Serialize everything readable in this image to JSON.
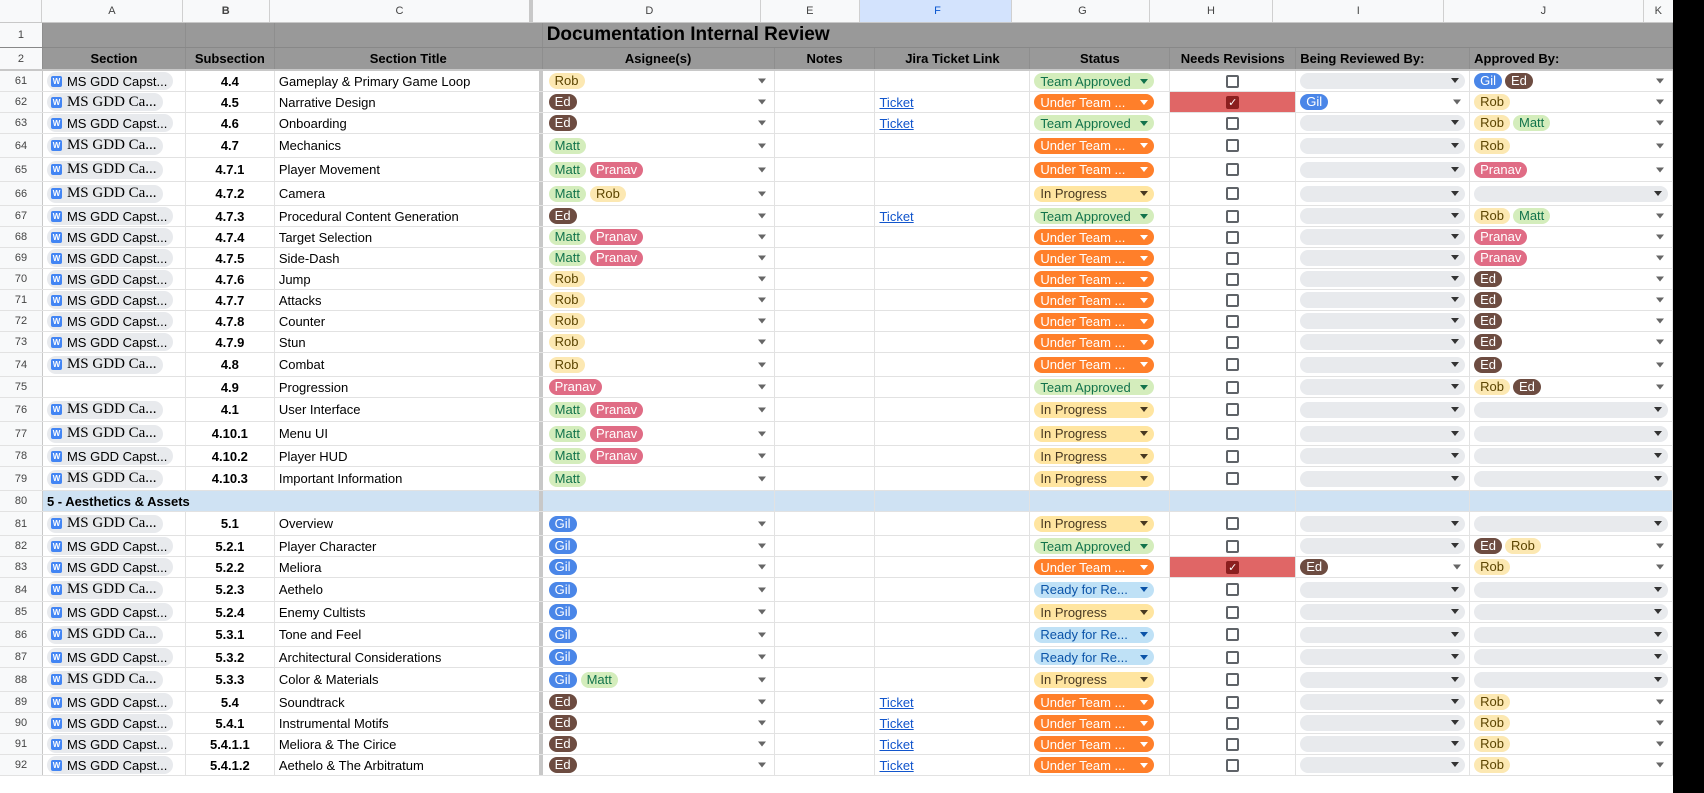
{
  "columns": [
    "A",
    "B",
    "C",
    "D",
    "E",
    "F",
    "G",
    "H",
    "I",
    "J",
    "K"
  ],
  "selected_column": "F",
  "title": "Documentation Internal Review",
  "headers": {
    "section": "Section",
    "subsection": "Subsection",
    "section_title": "Section Title",
    "assignees": "Asignee(s)",
    "notes": "Notes",
    "jira": "Jira Ticket Link",
    "status": "Status",
    "needs_revisions": "Needs Revisions",
    "being_reviewed_by": "Being Reviewed By:",
    "approved_by": "Approved By:"
  },
  "row_numbers": {
    "r1": "1",
    "r2": "2"
  },
  "colors": {
    "header_bg": "#999999",
    "section_bg": "#cfe2f3",
    "flag_bg": "#e06666"
  },
  "rows": [
    {
      "n": "61",
      "doc": "MS GDD Capst...",
      "serif": false,
      "sub": "4.4",
      "title": "Gameplay & Primary Game Loop",
      "assignees": [
        {
          "name": "Rob",
          "c": "rob"
        }
      ],
      "ticket": "",
      "status": "Team Approved",
      "sc": "st-approved",
      "needs": false,
      "reviewed": [],
      "approved": [
        {
          "name": "Gil",
          "c": "gil"
        },
        {
          "name": "Ed",
          "c": "ed"
        }
      ],
      "tall": false
    },
    {
      "n": "62",
      "doc": "MS GDD Ca...",
      "serif": true,
      "sub": "4.5",
      "title": "Narrative Design",
      "assignees": [
        {
          "name": "Ed",
          "c": "ed"
        }
      ],
      "ticket": "Ticket",
      "status": "Under Team ...",
      "sc": "st-under",
      "needs": true,
      "reviewed": [
        {
          "name": "Gil",
          "c": "gil"
        }
      ],
      "approved": [
        {
          "name": "Rob",
          "c": "rob"
        }
      ],
      "tall": false
    },
    {
      "n": "63",
      "doc": "MS GDD Capst...",
      "serif": false,
      "sub": "4.6",
      "title": "Onboarding",
      "assignees": [
        {
          "name": "Ed",
          "c": "ed"
        }
      ],
      "ticket": "Ticket",
      "status": "Team Approved",
      "sc": "st-approved",
      "needs": false,
      "reviewed": [],
      "approved": [
        {
          "name": "Rob",
          "c": "rob"
        },
        {
          "name": "Matt",
          "c": "matt"
        }
      ],
      "tall": false
    },
    {
      "n": "64",
      "doc": "MS GDD Ca...",
      "serif": true,
      "sub": "4.7",
      "title": "Mechanics",
      "assignees": [
        {
          "name": "Matt",
          "c": "matt"
        }
      ],
      "ticket": "",
      "status": "Under Team ...",
      "sc": "st-under",
      "needs": false,
      "reviewed": [],
      "approved": [
        {
          "name": "Rob",
          "c": "rob"
        }
      ],
      "tall": true
    },
    {
      "n": "65",
      "doc": "MS GDD Ca...",
      "serif": true,
      "sub": "4.7.1",
      "title": "Player Movement",
      "assignees": [
        {
          "name": "Matt",
          "c": "matt"
        },
        {
          "name": "Pranav",
          "c": "pranav"
        }
      ],
      "ticket": "",
      "status": "Under Team ...",
      "sc": "st-under",
      "needs": false,
      "reviewed": [],
      "approved": [
        {
          "name": "Pranav",
          "c": "pranav"
        }
      ],
      "tall": true
    },
    {
      "n": "66",
      "doc": "MS GDD Ca...",
      "serif": true,
      "sub": "4.7.2",
      "title": "Camera",
      "assignees": [
        {
          "name": "Matt",
          "c": "matt"
        },
        {
          "name": "Rob",
          "c": "rob"
        }
      ],
      "ticket": "",
      "status": "In Progress",
      "sc": "st-progress",
      "needs": false,
      "reviewed": [],
      "approved": [],
      "tall": true
    },
    {
      "n": "67",
      "doc": "MS GDD Capst...",
      "serif": false,
      "sub": "4.7.3",
      "title": "Procedural Content Generation",
      "assignees": [
        {
          "name": "Ed",
          "c": "ed"
        }
      ],
      "ticket": "Ticket",
      "status": "Team Approved",
      "sc": "st-approved",
      "needs": false,
      "reviewed": [],
      "approved": [
        {
          "name": "Rob",
          "c": "rob"
        },
        {
          "name": "Matt",
          "c": "matt"
        }
      ],
      "tall": false
    },
    {
      "n": "68",
      "doc": "MS GDD Capst...",
      "serif": false,
      "sub": "4.7.4",
      "title": "Target Selection",
      "assignees": [
        {
          "name": "Matt",
          "c": "matt"
        },
        {
          "name": "Pranav",
          "c": "pranav"
        }
      ],
      "ticket": "",
      "status": "Under Team ...",
      "sc": "st-under",
      "needs": false,
      "reviewed": [],
      "approved": [
        {
          "name": "Pranav",
          "c": "pranav"
        }
      ],
      "tall": false
    },
    {
      "n": "69",
      "doc": "MS GDD Capst...",
      "serif": false,
      "sub": "4.7.5",
      "title": "Side-Dash",
      "assignees": [
        {
          "name": "Matt",
          "c": "matt"
        },
        {
          "name": "Pranav",
          "c": "pranav"
        }
      ],
      "ticket": "",
      "status": "Under Team ...",
      "sc": "st-under",
      "needs": false,
      "reviewed": [],
      "approved": [
        {
          "name": "Pranav",
          "c": "pranav"
        }
      ],
      "tall": false
    },
    {
      "n": "70",
      "doc": "MS GDD Capst...",
      "serif": false,
      "sub": "4.7.6",
      "title": "Jump",
      "assignees": [
        {
          "name": "Rob",
          "c": "rob"
        }
      ],
      "ticket": "",
      "status": "Under Team ...",
      "sc": "st-under",
      "needs": false,
      "reviewed": [],
      "approved": [
        {
          "name": "Ed",
          "c": "ed"
        }
      ],
      "tall": false
    },
    {
      "n": "71",
      "doc": "MS GDD Capst...",
      "serif": false,
      "sub": "4.7.7",
      "title": "Attacks",
      "assignees": [
        {
          "name": "Rob",
          "c": "rob"
        }
      ],
      "ticket": "",
      "status": "Under Team ...",
      "sc": "st-under",
      "needs": false,
      "reviewed": [],
      "approved": [
        {
          "name": "Ed",
          "c": "ed"
        }
      ],
      "tall": false
    },
    {
      "n": "72",
      "doc": "MS GDD Capst...",
      "serif": false,
      "sub": "4.7.8",
      "title": "Counter",
      "assignees": [
        {
          "name": "Rob",
          "c": "rob"
        }
      ],
      "ticket": "",
      "status": "Under Team ...",
      "sc": "st-under",
      "needs": false,
      "reviewed": [],
      "approved": [
        {
          "name": "Ed",
          "c": "ed"
        }
      ],
      "tall": false
    },
    {
      "n": "73",
      "doc": "MS GDD Capst...",
      "serif": false,
      "sub": "4.7.9",
      "title": "Stun",
      "assignees": [
        {
          "name": "Rob",
          "c": "rob"
        }
      ],
      "ticket": "",
      "status": "Under Team ...",
      "sc": "st-under",
      "needs": false,
      "reviewed": [],
      "approved": [
        {
          "name": "Ed",
          "c": "ed"
        }
      ],
      "tall": false
    },
    {
      "n": "74",
      "doc": "MS GDD Ca...",
      "serif": true,
      "sub": "4.8",
      "title": "Combat",
      "assignees": [
        {
          "name": "Rob",
          "c": "rob"
        }
      ],
      "ticket": "",
      "status": "Under Team ...",
      "sc": "st-under",
      "needs": false,
      "reviewed": [],
      "approved": [
        {
          "name": "Ed",
          "c": "ed"
        }
      ],
      "tall": true
    },
    {
      "n": "75",
      "doc": "",
      "serif": false,
      "sub": "4.9",
      "title": "Progression",
      "assignees": [
        {
          "name": "Pranav",
          "c": "pranav"
        }
      ],
      "ticket": "",
      "status": "Team Approved",
      "sc": "st-approved",
      "needs": false,
      "reviewed": [],
      "approved": [
        {
          "name": "Rob",
          "c": "rob"
        },
        {
          "name": "Ed",
          "c": "ed"
        }
      ],
      "tall": false
    },
    {
      "n": "76",
      "doc": "MS GDD Ca...",
      "serif": true,
      "sub": "4.1",
      "title": "User Interface",
      "assignees": [
        {
          "name": "Matt",
          "c": "matt"
        },
        {
          "name": "Pranav",
          "c": "pranav"
        }
      ],
      "ticket": "",
      "status": "In Progress",
      "sc": "st-progress",
      "needs": false,
      "reviewed": [],
      "approved": [],
      "tall": true
    },
    {
      "n": "77",
      "doc": "MS GDD Ca...",
      "serif": true,
      "sub": "4.10.1",
      "title": "Menu UI",
      "assignees": [
        {
          "name": "Matt",
          "c": "matt"
        },
        {
          "name": "Pranav",
          "c": "pranav"
        }
      ],
      "ticket": "",
      "status": "In Progress",
      "sc": "st-progress",
      "needs": false,
      "reviewed": [],
      "approved": [],
      "tall": true
    },
    {
      "n": "78",
      "doc": "MS GDD Capst...",
      "serif": false,
      "sub": "4.10.2",
      "title": "Player HUD",
      "assignees": [
        {
          "name": "Matt",
          "c": "matt"
        },
        {
          "name": "Pranav",
          "c": "pranav"
        }
      ],
      "ticket": "",
      "status": "In Progress",
      "sc": "st-progress",
      "needs": false,
      "reviewed": [],
      "approved": [],
      "tall": false
    },
    {
      "n": "79",
      "doc": "MS GDD Ca...",
      "serif": true,
      "sub": "4.10.3",
      "title": "Important Information",
      "assignees": [
        {
          "name": "Matt",
          "c": "matt"
        }
      ],
      "ticket": "",
      "status": "In Progress",
      "sc": "st-progress",
      "needs": false,
      "reviewed": [],
      "approved": [],
      "tall": true
    },
    {
      "n": "80",
      "section": "5 - Aesthetics & Assets"
    },
    {
      "n": "81",
      "doc": "MS GDD Ca...",
      "serif": true,
      "sub": "5.1",
      "title": "Overview",
      "assignees": [
        {
          "name": "Gil",
          "c": "gil"
        }
      ],
      "ticket": "",
      "status": "In Progress",
      "sc": "st-progress",
      "needs": false,
      "reviewed": [],
      "approved": [],
      "tall": true
    },
    {
      "n": "82",
      "doc": "MS GDD Capst...",
      "serif": false,
      "sub": "5.2.1",
      "title": "Player Character",
      "assignees": [
        {
          "name": "Gil",
          "c": "gil"
        }
      ],
      "ticket": "",
      "status": "Team Approved",
      "sc": "st-approved",
      "needs": false,
      "reviewed": [],
      "approved": [
        {
          "name": "Ed",
          "c": "ed"
        },
        {
          "name": "Rob",
          "c": "rob"
        }
      ],
      "tall": false
    },
    {
      "n": "83",
      "doc": "MS GDD Capst...",
      "serif": false,
      "sub": "5.2.2",
      "title": "Meliora",
      "assignees": [
        {
          "name": "Gil",
          "c": "gil"
        }
      ],
      "ticket": "",
      "status": "Under Team ...",
      "sc": "st-under",
      "needs": true,
      "reviewed": [
        {
          "name": "Ed",
          "c": "ed"
        }
      ],
      "approved": [
        {
          "name": "Rob",
          "c": "rob"
        }
      ],
      "tall": false
    },
    {
      "n": "84",
      "doc": "MS GDD Ca...",
      "serif": true,
      "sub": "5.2.3",
      "title": "Aethelo",
      "assignees": [
        {
          "name": "Gil",
          "c": "gil"
        }
      ],
      "ticket": "",
      "status": "Ready for Re...",
      "sc": "st-ready",
      "needs": false,
      "reviewed": [],
      "approved": [],
      "tall": true
    },
    {
      "n": "85",
      "doc": "MS GDD Capst...",
      "serif": false,
      "sub": "5.2.4",
      "title": "Enemy Cultists",
      "assignees": [
        {
          "name": "Gil",
          "c": "gil"
        }
      ],
      "ticket": "",
      "status": "In Progress",
      "sc": "st-progress",
      "needs": false,
      "reviewed": [],
      "approved": [],
      "tall": false
    },
    {
      "n": "86",
      "doc": "MS GDD Ca...",
      "serif": true,
      "sub": "5.3.1",
      "title": "Tone and Feel",
      "assignees": [
        {
          "name": "Gil",
          "c": "gil"
        }
      ],
      "ticket": "",
      "status": "Ready for Re...",
      "sc": "st-ready",
      "needs": false,
      "reviewed": [],
      "approved": [],
      "tall": true
    },
    {
      "n": "87",
      "doc": "MS GDD Capst...",
      "serif": false,
      "sub": "5.3.2",
      "title": "Architectural Considerations",
      "assignees": [
        {
          "name": "Gil",
          "c": "gil"
        }
      ],
      "ticket": "",
      "status": "Ready for Re...",
      "sc": "st-ready",
      "needs": false,
      "reviewed": [],
      "approved": [],
      "tall": false
    },
    {
      "n": "88",
      "doc": "MS GDD Ca...",
      "serif": true,
      "sub": "5.3.3",
      "title": "Color & Materials",
      "assignees": [
        {
          "name": "Gil",
          "c": "gil"
        },
        {
          "name": "Matt",
          "c": "matt"
        }
      ],
      "ticket": "",
      "status": "In Progress",
      "sc": "st-progress",
      "needs": false,
      "reviewed": [],
      "approved": [],
      "tall": true
    },
    {
      "n": "89",
      "doc": "MS GDD Capst...",
      "serif": false,
      "sub": "5.4",
      "title": "Soundtrack",
      "assignees": [
        {
          "name": "Ed",
          "c": "ed"
        }
      ],
      "ticket": "Ticket",
      "status": "Under Team ...",
      "sc": "st-under",
      "needs": false,
      "reviewed": [],
      "approved": [
        {
          "name": "Rob",
          "c": "rob"
        }
      ],
      "tall": false
    },
    {
      "n": "90",
      "doc": "MS GDD Capst...",
      "serif": false,
      "sub": "5.4.1",
      "title": "Instrumental Motifs",
      "assignees": [
        {
          "name": "Ed",
          "c": "ed"
        }
      ],
      "ticket": "Ticket",
      "status": "Under Team ...",
      "sc": "st-under",
      "needs": false,
      "reviewed": [],
      "approved": [
        {
          "name": "Rob",
          "c": "rob"
        }
      ],
      "tall": false
    },
    {
      "n": "91",
      "doc": "MS GDD Capst...",
      "serif": false,
      "sub": "5.4.1.1",
      "title": "Meliora & The Cirice",
      "assignees": [
        {
          "name": "Ed",
          "c": "ed"
        }
      ],
      "ticket": "Ticket",
      "status": "Under Team ...",
      "sc": "st-under",
      "needs": false,
      "reviewed": [],
      "approved": [
        {
          "name": "Rob",
          "c": "rob"
        }
      ],
      "tall": false
    },
    {
      "n": "92",
      "doc": "MS GDD Capst...",
      "serif": false,
      "sub": "5.4.1.2",
      "title": "Aethelo & The Arbitratum",
      "assignees": [
        {
          "name": "Ed",
          "c": "ed"
        }
      ],
      "ticket": "Ticket",
      "status": "Under Team ...",
      "sc": "st-under",
      "needs": false,
      "reviewed": [],
      "approved": [
        {
          "name": "Rob",
          "c": "rob"
        }
      ],
      "tall": false
    }
  ]
}
